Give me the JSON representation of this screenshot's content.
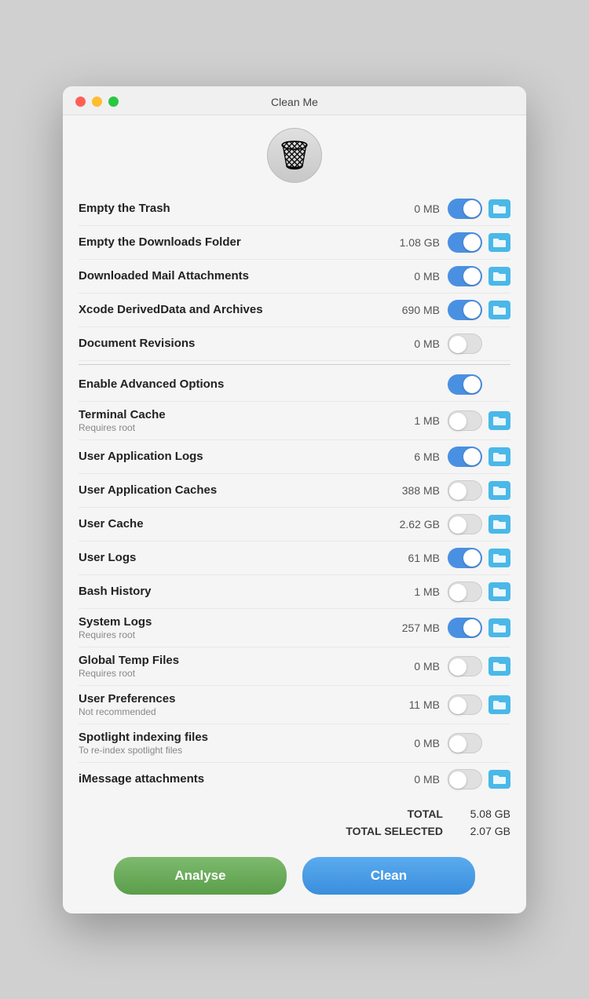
{
  "window": {
    "title": "Clean Me"
  },
  "buttons": {
    "analyse": "Analyse",
    "clean": "Clean"
  },
  "totals": {
    "total_label": "TOTAL",
    "total_value": "5.08 GB",
    "selected_label": "TOTAL SELECTED",
    "selected_value": "2.07 GB"
  },
  "items": [
    {
      "id": "empty-trash",
      "name": "Empty the Trash",
      "sub": "",
      "size": "0 MB",
      "toggled": true,
      "has_folder": true
    },
    {
      "id": "downloads-folder",
      "name": "Empty the Downloads Folder",
      "sub": "",
      "size": "1.08 GB",
      "toggled": true,
      "has_folder": true
    },
    {
      "id": "mail-attachments",
      "name": "Downloaded Mail Attachments",
      "sub": "",
      "size": "0 MB",
      "toggled": true,
      "has_folder": true
    },
    {
      "id": "xcode-data",
      "name": "Xcode DerivedData and Archives",
      "sub": "",
      "size": "690 MB",
      "toggled": true,
      "has_folder": true
    },
    {
      "id": "doc-revisions",
      "name": "Document Revisions",
      "sub": "",
      "size": "0 MB",
      "toggled": false,
      "has_folder": false
    },
    {
      "id": "advanced-options",
      "name": "Enable Advanced Options",
      "sub": "",
      "size": "",
      "toggled": true,
      "has_folder": false,
      "is_separator": true
    },
    {
      "id": "terminal-cache",
      "name": "Terminal Cache",
      "sub": "Requires root",
      "size": "1 MB",
      "toggled": false,
      "has_folder": true
    },
    {
      "id": "app-logs",
      "name": "User Application Logs",
      "sub": "",
      "size": "6 MB",
      "toggled": true,
      "has_folder": true
    },
    {
      "id": "app-caches",
      "name": "User Application Caches",
      "sub": "",
      "size": "388 MB",
      "toggled": false,
      "has_folder": true
    },
    {
      "id": "user-cache",
      "name": "User Cache",
      "sub": "",
      "size": "2.62 GB",
      "toggled": false,
      "has_folder": true
    },
    {
      "id": "user-logs",
      "name": "User Logs",
      "sub": "",
      "size": "61 MB",
      "toggled": true,
      "has_folder": true
    },
    {
      "id": "bash-history",
      "name": "Bash History",
      "sub": "",
      "size": "1 MB",
      "toggled": false,
      "has_folder": true
    },
    {
      "id": "system-logs",
      "name": "System Logs",
      "sub": "Requires root",
      "size": "257 MB",
      "toggled": true,
      "has_folder": true
    },
    {
      "id": "global-temp",
      "name": "Global Temp Files",
      "sub": "Requires root",
      "size": "0 MB",
      "toggled": false,
      "has_folder": true
    },
    {
      "id": "user-prefs",
      "name": "User Preferences",
      "sub": "Not recommended",
      "size": "11 MB",
      "toggled": false,
      "has_folder": true
    },
    {
      "id": "spotlight-files",
      "name": "Spotlight indexing files",
      "sub": "To re-index spotlight files",
      "size": "0 MB",
      "toggled": false,
      "has_folder": false
    },
    {
      "id": "imessage",
      "name": "iMessage attachments",
      "sub": "",
      "size": "0 MB",
      "toggled": false,
      "has_folder": true
    }
  ]
}
